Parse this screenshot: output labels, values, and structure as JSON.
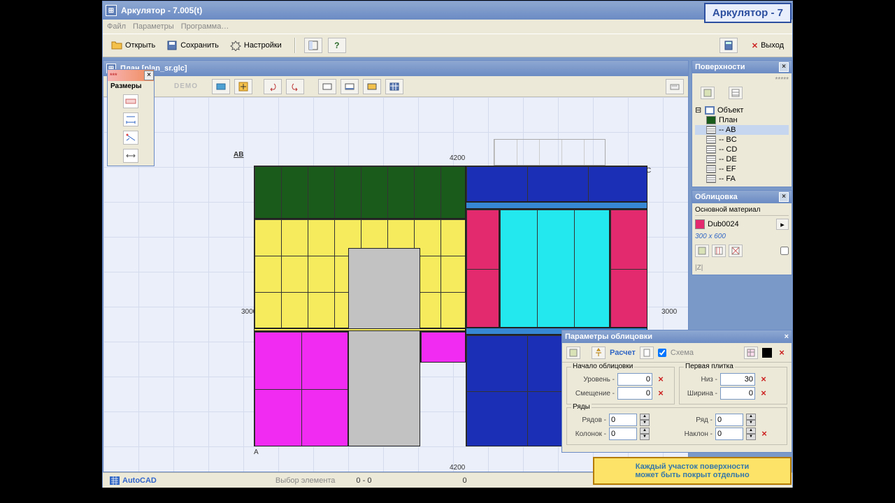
{
  "app": {
    "title": "Аркулятор - 7.005(t)"
  },
  "menu": {
    "file": "Файл",
    "params": "Параметры",
    "program": "Программа…"
  },
  "toolbar": {
    "open": "Открыть",
    "save": "Сохранить",
    "settings": "Настройки",
    "exit": "Выход"
  },
  "child": {
    "title": "План [plan_sr.glc]",
    "demo": "DEMO"
  },
  "sizes_panel": {
    "title": "***",
    "label": "Размеры"
  },
  "dims": {
    "ab": "AB",
    "w1": "4200",
    "w2": "4200",
    "h1": "3000",
    "h2": "3000",
    "pt_a": "A",
    "pt_c": "C"
  },
  "surfaces_panel": {
    "title": "Поверхности",
    "root": "Объект",
    "items": [
      "План",
      "-- AB",
      "-- BC",
      "-- CD",
      "-- DE",
      "-- EF",
      "-- FA"
    ]
  },
  "facing_panel": {
    "title": "Облицовка",
    "material_label": "Основной материал",
    "material": "Dub0024",
    "size": "300 x 600",
    "zz": "|Z|"
  },
  "params_dialog": {
    "title": "Параметры облицовки",
    "calc": "Расчет",
    "scheme": "Схема",
    "start_group": "Начало облицовки",
    "first_group": "Первая плитка",
    "rows_group": "Ряды",
    "level": "Уровень -",
    "level_v": "0",
    "offset": "Смещение -",
    "offset_v": "0",
    "bottom": "Низ -",
    "bottom_v": "30",
    "width": "Ширина -",
    "width_v": "0",
    "rows": "Рядов -",
    "rows_v": "0",
    "row": "Ряд -",
    "row_v": "0",
    "cols": "Колонок -",
    "cols_v": "0",
    "tilt": "Наклон -",
    "tilt_v": "0"
  },
  "status": {
    "autocad": "AutoCAD",
    "pick": "Выбор элемента",
    "coord1": "0 - 0",
    "coord2": "0"
  },
  "brand": "Аркулятор - 7",
  "hint": {
    "line1": "Каждый участок поверхности",
    "line2": "может быть покрыт отдельно"
  },
  "login": "*****"
}
